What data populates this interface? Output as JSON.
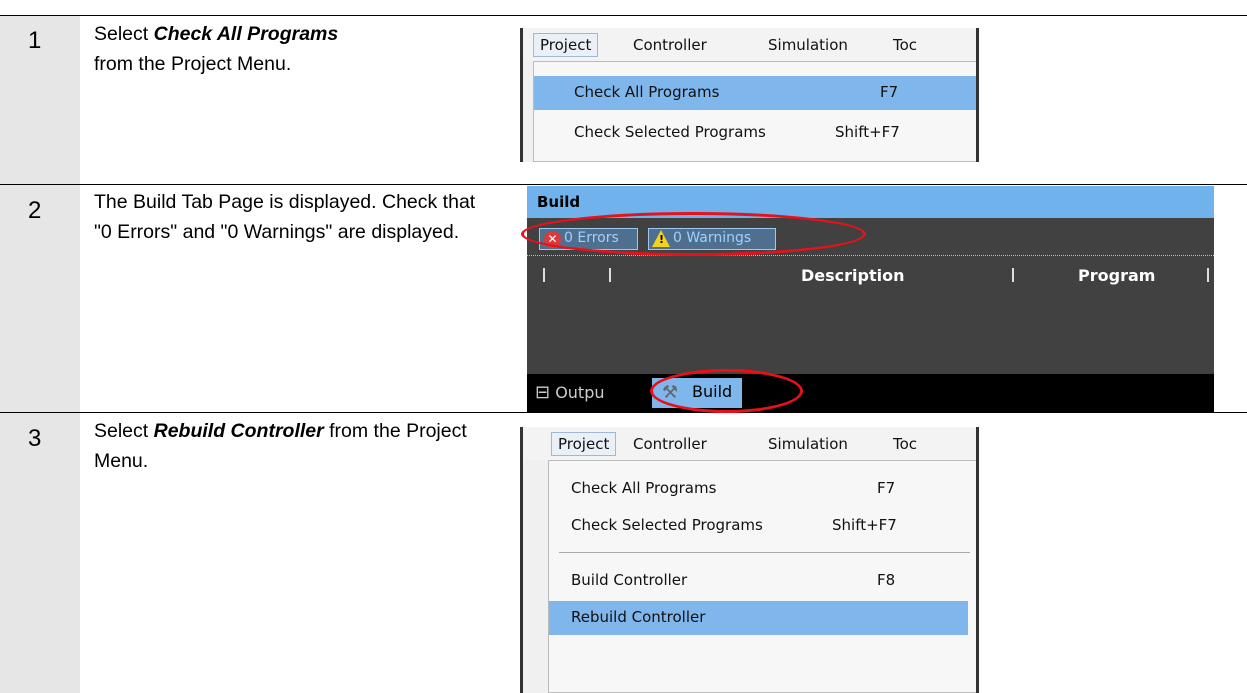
{
  "steps": [
    {
      "number": "1",
      "desc_pre": "Select ",
      "desc_em": "Check All Programs",
      "desc_post": "from the Project Menu."
    },
    {
      "number": "2",
      "desc_text": "The Build Tab Page is displayed. Check that \"0 Errors\" and \"0 Warnings\" are displayed."
    },
    {
      "number": "3",
      "desc_pre": "Select ",
      "desc_em": "Rebuild Controller",
      "desc_post": " from the Project Menu."
    }
  ],
  "menu_bar": {
    "project": "Project",
    "controller": "Controller",
    "simulation": "Simulation",
    "tools_partial": "Toc"
  },
  "menu_items": {
    "check_all": "Check All Programs",
    "check_all_key": "F7",
    "check_selected": "Check Selected Programs",
    "check_selected_key": "Shift+F7",
    "build_controller": "Build Controller",
    "build_controller_key": "F8",
    "rebuild_controller": "Rebuild Controller"
  },
  "build_panel": {
    "title": "Build",
    "errors": "0  Errors",
    "warnings": "0  Warnings",
    "col_description": "Description",
    "col_program": "Program",
    "tab_output": "Outpu",
    "tab_build": "Build"
  },
  "icons": [
    "error-icon",
    "warning-icon",
    "output-window-icon",
    "hammer-icon"
  ],
  "colors": {
    "highlight": "#7fb6ec",
    "annotation": "#e8111b",
    "step_bg": "#e6e6e6"
  }
}
